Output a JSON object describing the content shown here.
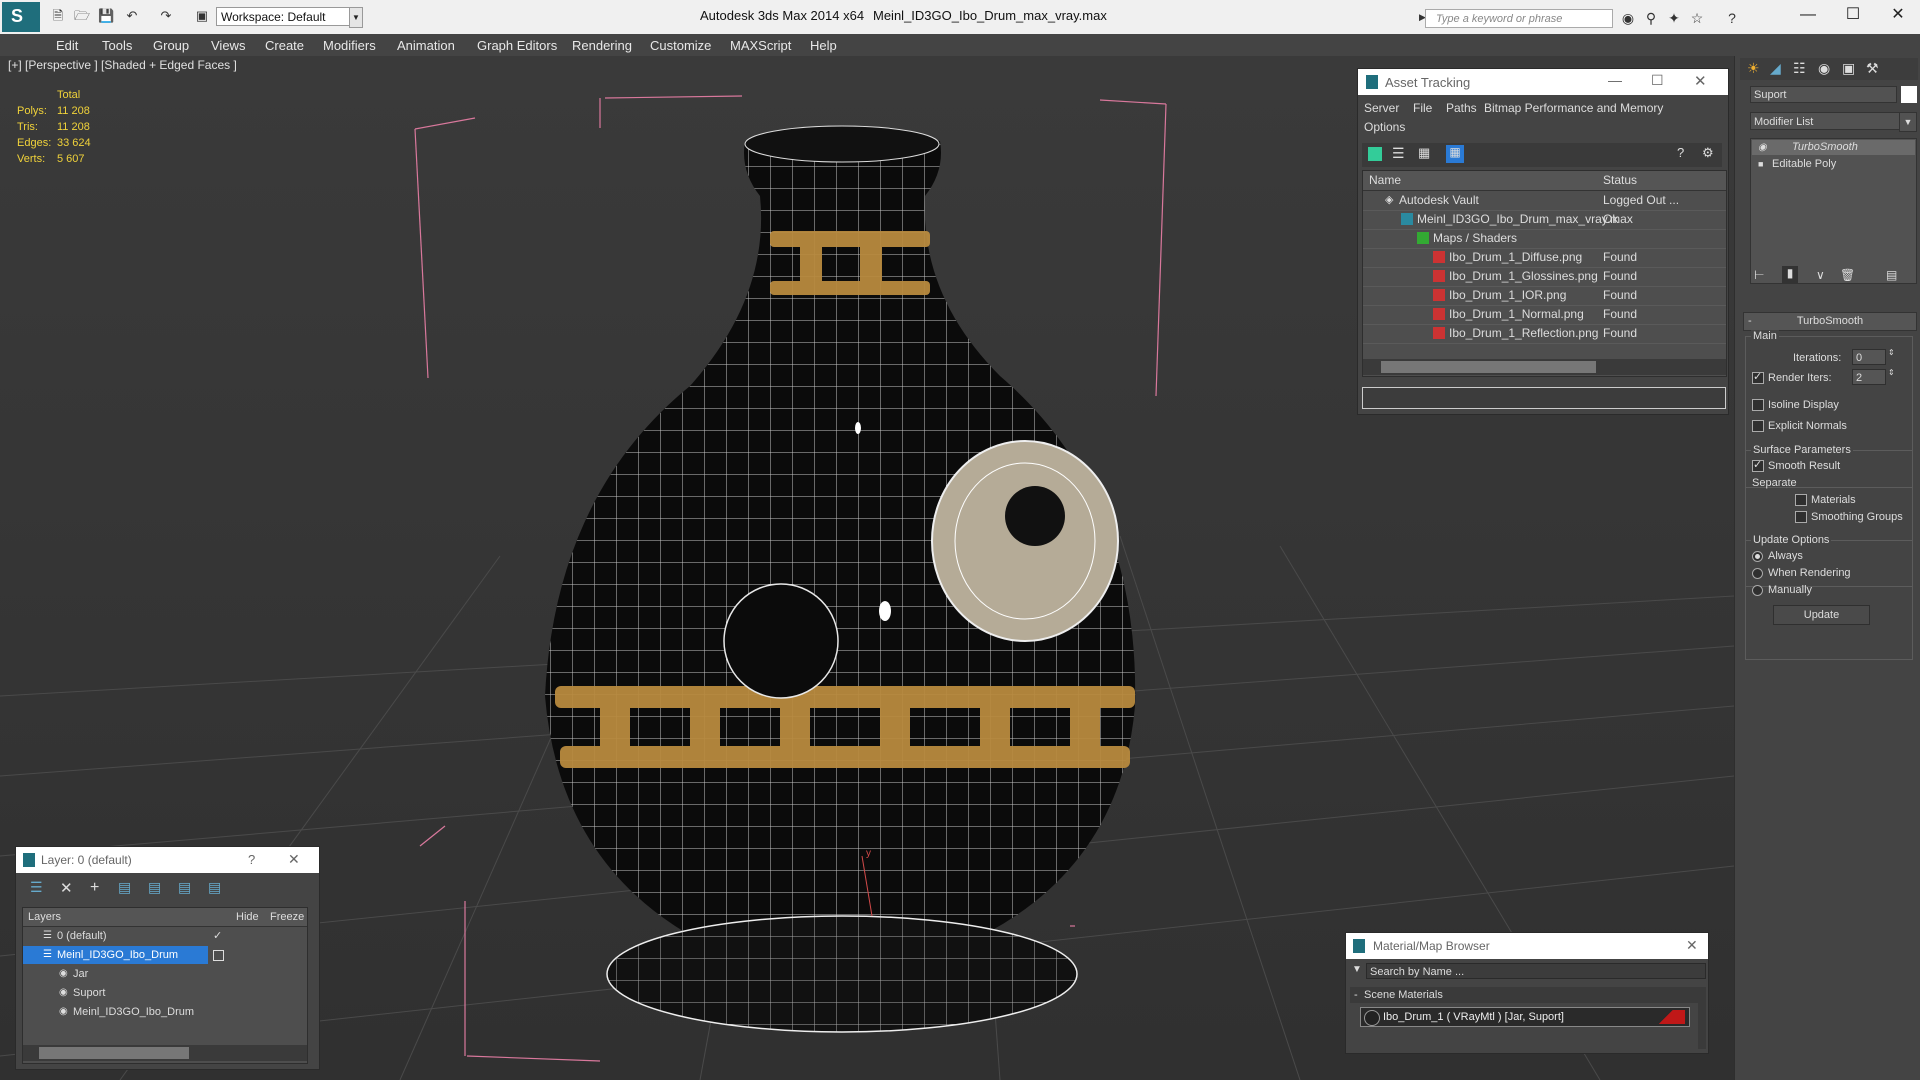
{
  "title_bar": {
    "app_title": "Autodesk 3ds Max  2014 x64",
    "file_title": "Meinl_ID3GO_Ibo_Drum_max_vray.max",
    "workspace_label": "Workspace: Default",
    "search_placeholder": "Type a keyword or phrase"
  },
  "menu": {
    "items": [
      "Edit",
      "Tools",
      "Group",
      "Views",
      "Create",
      "Modifiers",
      "Animation",
      "Graph Editors",
      "Rendering",
      "Customize",
      "MAXScript",
      "Help"
    ]
  },
  "viewport": {
    "label": "[+] [Perspective ] [Shaded + Edged Faces ]",
    "stats": {
      "header": "Total",
      "rows": [
        {
          "label": "Polys:",
          "value": "11 208"
        },
        {
          "label": "Tris:",
          "value": "11 208"
        },
        {
          "label": "Edges:",
          "value": "33 624"
        },
        {
          "label": "Verts:",
          "value": "5 607"
        }
      ]
    },
    "axis_label": "y"
  },
  "asset_tracking": {
    "title": "Asset Tracking",
    "menu": [
      "Server",
      "File",
      "Paths",
      "Bitmap Performance and Memory",
      "Options"
    ],
    "columns": [
      "Name",
      "Status"
    ],
    "rows": [
      {
        "name": "Autodesk Vault",
        "status": "Logged Out ..."
      },
      {
        "name": "Meinl_ID3GO_Ibo_Drum_max_vray.max",
        "status": "Ok"
      },
      {
        "name": "Maps / Shaders",
        "status": ""
      },
      {
        "name": "Ibo_Drum_1_Diffuse.png",
        "status": "Found"
      },
      {
        "name": "Ibo_Drum_1_Glossines.png",
        "status": "Found"
      },
      {
        "name": "Ibo_Drum_1_IOR.png",
        "status": "Found"
      },
      {
        "name": "Ibo_Drum_1_Normal.png",
        "status": "Found"
      },
      {
        "name": "Ibo_Drum_1_Reflection.png",
        "status": "Found"
      }
    ]
  },
  "command_panel": {
    "object_name": "Suport",
    "modifier_list": "Modifier List",
    "stack": [
      "TurboSmooth",
      "Editable Poly"
    ],
    "rollout_title": "TurboSmooth",
    "main_group": "Main",
    "iterations_label": "Iterations:",
    "iterations_value": "0",
    "render_iters_label": "Render Iters:",
    "render_iters_value": "2",
    "isoline": "Isoline Display",
    "explicit_normals": "Explicit Normals",
    "surface_group": "Surface Parameters",
    "smooth_result": "Smooth Result",
    "separate": "Separate",
    "materials": "Materials",
    "smoothing_groups": "Smoothing Groups",
    "update_group": "Update Options",
    "always": "Always",
    "when_rendering": "When Rendering",
    "manually": "Manually",
    "update_button": "Update"
  },
  "layer_dialog": {
    "title": "Layer: 0 (default)",
    "columns": [
      "Layers",
      "Hide",
      "Freeze"
    ],
    "rows": [
      "0 (default)",
      "Meinl_ID3GO_Ibo_Drum",
      "Jar",
      "Suport",
      "Meinl_ID3GO_Ibo_Drum"
    ]
  },
  "material_browser": {
    "title": "Material/Map Browser",
    "search_placeholder": "Search by Name ...",
    "section": "Scene Materials",
    "item": "Ibo_Drum_1  ( VRayMtl ) [Jar, Suport]"
  },
  "colors": {
    "accent": "#1f6e7c",
    "selection": "#2a7ad5",
    "stats": "#f0d23a",
    "pattern": "#b88a3e"
  }
}
